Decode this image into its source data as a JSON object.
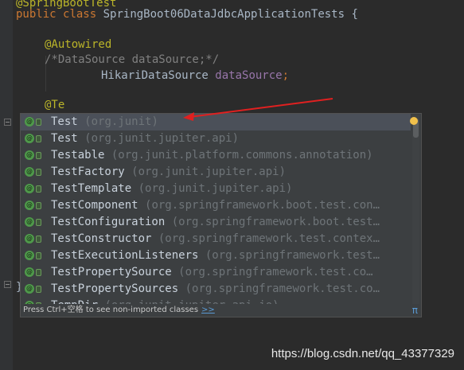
{
  "editor": {
    "line_annotation_top": "@SpringBootTest",
    "line_class_kw1": "public",
    "line_class_kw2": "class",
    "line_class_name": "SpringBoot06DataJdbcApplicationTests",
    "line_class_brace": "{",
    "line_autowired": "@Autowired",
    "line_comment": "/*DataSource dataSource;*/",
    "line_field_type": "HikariDataSource",
    "line_field_name": "dataSource",
    "line_field_semicolon": ";",
    "line_typed": "@Te",
    "line_close_brace": "}"
  },
  "completion": {
    "items": [
      {
        "name": "Test",
        "package": "(org.junit)"
      },
      {
        "name": "Test",
        "package": "(org.junit.jupiter.api)"
      },
      {
        "name": "Testable",
        "package": "(org.junit.platform.commons.annotation)"
      },
      {
        "name": "TestFactory",
        "package": "(org.junit.jupiter.api)"
      },
      {
        "name": "TestTemplate",
        "package": "(org.junit.jupiter.api)"
      },
      {
        "name": "TestComponent",
        "package": "(org.springframework.boot.test.con…"
      },
      {
        "name": "TestConfiguration",
        "package": "(org.springframework.boot.test…"
      },
      {
        "name": "TestConstructor",
        "package": "(org.springframework.test.contex…"
      },
      {
        "name": "TestExecutionListeners",
        "package": "(org.springframework.test…"
      },
      {
        "name": "TestPropertySource",
        "package": "(org.springframework.test.co…"
      },
      {
        "name": "TestPropertySources",
        "package": "(org.springframework.test.co…"
      },
      {
        "name": "TempDir",
        "package": "(org.junit.jupiter.api.io)"
      }
    ],
    "selected_index": 0,
    "footer_hint": "Press Ctrl+空格 to see non-imported classes",
    "footer_more": ">>",
    "footer_pi": "π",
    "class_icon": "class-annotation-icon",
    "visibility_icon": "public-visibility-icon"
  },
  "watermark": "https://blog.csdn.net/qq_43377329",
  "colors": {
    "background": "#2b2b2b",
    "popup": "#3c3f41",
    "selection": "#4b5059",
    "arrow": "#e02020"
  }
}
